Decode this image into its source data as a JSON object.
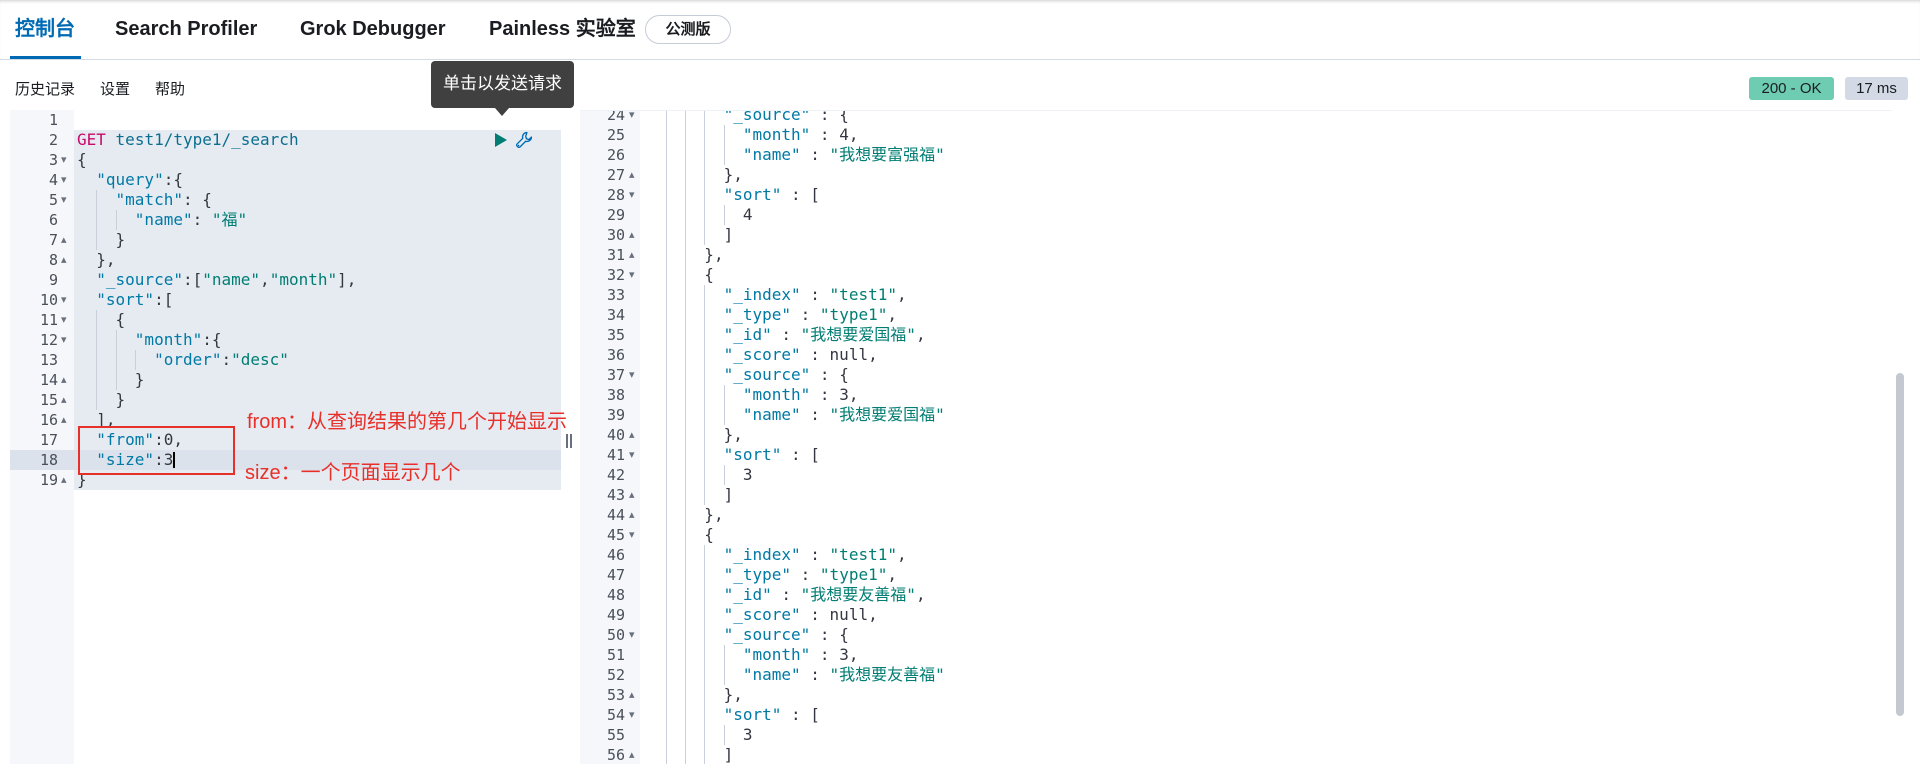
{
  "app": {
    "tabs": [
      {
        "label": "控制台",
        "active": true
      },
      {
        "label": "Search Profiler",
        "active": false
      },
      {
        "label": "Grok Debugger",
        "active": false
      },
      {
        "label": "Painless 实验室",
        "active": false
      }
    ],
    "beta_badge": "公测版"
  },
  "toolbar": {
    "history": "历史记录",
    "settings": "设置",
    "help": "帮助"
  },
  "status": {
    "code": "200 - OK",
    "time": "17 ms"
  },
  "tooltip": {
    "text": "单击以发送请求"
  },
  "icons": {
    "run": "play-icon",
    "settings": "wrench-icon",
    "fold_open": "fold-open-icon",
    "fold_close": "fold-close-icon"
  },
  "colors": {
    "accent": "#006bb4",
    "status_ok": "#6dccb1",
    "status_time": "#d3dae6",
    "annotation": "#e8302a",
    "method": "#c80a68",
    "url": "#0b6e8e",
    "key": "#0079a5",
    "string": "#017d73",
    "text": "#343741"
  },
  "request_editor": {
    "active_line": 18,
    "cursor_column": 10,
    "request_range": [
      2,
      19
    ],
    "lines": [
      {
        "n": 1,
        "text": "",
        "fold": ""
      },
      {
        "n": 2,
        "text": "GET test1/type1/_search",
        "fold": ""
      },
      {
        "n": 3,
        "text": "{",
        "fold": "fold-open-icon"
      },
      {
        "n": 4,
        "text": "  \"query\":{",
        "fold": "fold-open-icon"
      },
      {
        "n": 5,
        "text": "    \"match\": {",
        "fold": "fold-open-icon"
      },
      {
        "n": 6,
        "text": "      \"name\": \"福\"",
        "fold": ""
      },
      {
        "n": 7,
        "text": "    }",
        "fold": "fold-close-icon"
      },
      {
        "n": 8,
        "text": "  },",
        "fold": "fold-close-icon"
      },
      {
        "n": 9,
        "text": "  \"_source\":[\"name\",\"month\"],",
        "fold": ""
      },
      {
        "n": 10,
        "text": "  \"sort\":[",
        "fold": "fold-open-icon"
      },
      {
        "n": 11,
        "text": "    {",
        "fold": "fold-open-icon"
      },
      {
        "n": 12,
        "text": "      \"month\":{",
        "fold": "fold-open-icon"
      },
      {
        "n": 13,
        "text": "        \"order\":\"desc\"",
        "fold": ""
      },
      {
        "n": 14,
        "text": "      }",
        "fold": "fold-close-icon"
      },
      {
        "n": 15,
        "text": "    }",
        "fold": "fold-close-icon"
      },
      {
        "n": 16,
        "text": "  ],",
        "fold": "fold-close-icon"
      },
      {
        "n": 17,
        "text": "  \"from\":0,",
        "fold": ""
      },
      {
        "n": 18,
        "text": "  \"size\":3",
        "fold": ""
      },
      {
        "n": 19,
        "text": "}",
        "fold": "fold-close-icon"
      }
    ]
  },
  "response_editor": {
    "lines": [
      {
        "n": 24,
        "text": "        \"_source\" : {",
        "fold": "fold-open-icon"
      },
      {
        "n": 25,
        "text": "          \"month\" : 4,",
        "fold": ""
      },
      {
        "n": 26,
        "text": "          \"name\" : \"我想要富强福\"",
        "fold": ""
      },
      {
        "n": 27,
        "text": "        },",
        "fold": "fold-close-icon"
      },
      {
        "n": 28,
        "text": "        \"sort\" : [",
        "fold": "fold-open-icon"
      },
      {
        "n": 29,
        "text": "          4",
        "fold": ""
      },
      {
        "n": 30,
        "text": "        ]",
        "fold": "fold-close-icon"
      },
      {
        "n": 31,
        "text": "      },",
        "fold": "fold-close-icon"
      },
      {
        "n": 32,
        "text": "      {",
        "fold": "fold-open-icon"
      },
      {
        "n": 33,
        "text": "        \"_index\" : \"test1\",",
        "fold": ""
      },
      {
        "n": 34,
        "text": "        \"_type\" : \"type1\",",
        "fold": ""
      },
      {
        "n": 35,
        "text": "        \"_id\" : \"我想要爱国福\",",
        "fold": ""
      },
      {
        "n": 36,
        "text": "        \"_score\" : null,",
        "fold": ""
      },
      {
        "n": 37,
        "text": "        \"_source\" : {",
        "fold": "fold-open-icon"
      },
      {
        "n": 38,
        "text": "          \"month\" : 3,",
        "fold": ""
      },
      {
        "n": 39,
        "text": "          \"name\" : \"我想要爱国福\"",
        "fold": ""
      },
      {
        "n": 40,
        "text": "        },",
        "fold": "fold-close-icon"
      },
      {
        "n": 41,
        "text": "        \"sort\" : [",
        "fold": "fold-open-icon"
      },
      {
        "n": 42,
        "text": "          3",
        "fold": ""
      },
      {
        "n": 43,
        "text": "        ]",
        "fold": "fold-close-icon"
      },
      {
        "n": 44,
        "text": "      },",
        "fold": "fold-close-icon"
      },
      {
        "n": 45,
        "text": "      {",
        "fold": "fold-open-icon"
      },
      {
        "n": 46,
        "text": "        \"_index\" : \"test1\",",
        "fold": ""
      },
      {
        "n": 47,
        "text": "        \"_type\" : \"type1\",",
        "fold": ""
      },
      {
        "n": 48,
        "text": "        \"_id\" : \"我想要友善福\",",
        "fold": ""
      },
      {
        "n": 49,
        "text": "        \"_score\" : null,",
        "fold": ""
      },
      {
        "n": 50,
        "text": "        \"_source\" : {",
        "fold": "fold-open-icon"
      },
      {
        "n": 51,
        "text": "          \"month\" : 3,",
        "fold": ""
      },
      {
        "n": 52,
        "text": "          \"name\" : \"我想要友善福\"",
        "fold": ""
      },
      {
        "n": 53,
        "text": "        },",
        "fold": "fold-close-icon"
      },
      {
        "n": 54,
        "text": "        \"sort\" : [",
        "fold": "fold-open-icon"
      },
      {
        "n": 55,
        "text": "          3",
        "fold": ""
      },
      {
        "n": 56,
        "text": "        ]",
        "fold": "fold-close-icon"
      }
    ]
  },
  "annotations": {
    "from_note": "from：从查询结果的第几个开始显示",
    "size_note": "size：一个页面显示几个"
  }
}
